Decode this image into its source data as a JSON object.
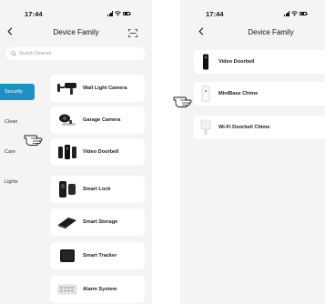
{
  "left_screen": {
    "status_time": "17:44",
    "back_icon": "chevron-left-icon",
    "title": "Device Family",
    "scan_icon": "scan-icon",
    "search": {
      "placeholder": "Search Devices",
      "icon": "search-icon"
    },
    "categories": [
      {
        "label": "Security",
        "active": true
      },
      {
        "label": "Clean",
        "active": false
      },
      {
        "label": "Care",
        "active": false
      },
      {
        "label": "Lights",
        "active": false
      }
    ],
    "devices": [
      {
        "label": "Wall Light Camera",
        "icon": "wall-light-camera-icon"
      },
      {
        "label": "Garage Camera",
        "icon": "garage-camera-icon"
      },
      {
        "label": "Video Doorbell",
        "icon": "video-doorbell-icon"
      },
      {
        "label": "Smart Lock",
        "icon": "smart-lock-icon"
      },
      {
        "label": "Smart Storage",
        "icon": "smart-storage-icon"
      },
      {
        "label": "Smart Tracker",
        "icon": "smart-tracker-icon"
      },
      {
        "label": "Alarm System",
        "icon": "alarm-system-icon"
      }
    ]
  },
  "right_screen": {
    "status_time": "17:44",
    "back_icon": "chevron-left-icon",
    "title": "Device Family",
    "devices": [
      {
        "label": "Video Doorbell",
        "icon": "video-doorbell-icon"
      },
      {
        "label": "MiniBase Chime",
        "icon": "minibase-chime-icon"
      },
      {
        "label": "Wi-Fi Doorbell Chime",
        "icon": "wifi-doorbell-chime-icon"
      }
    ]
  },
  "annotations": [
    {
      "icon": "pointing-hand-icon",
      "target": "Video Doorbell"
    },
    {
      "icon": "pointing-hand-icon",
      "target": "MiniBase Chime"
    }
  ],
  "colors": {
    "accent": "#1e90c8",
    "background": "#f4f4f4",
    "card": "#ffffff"
  }
}
